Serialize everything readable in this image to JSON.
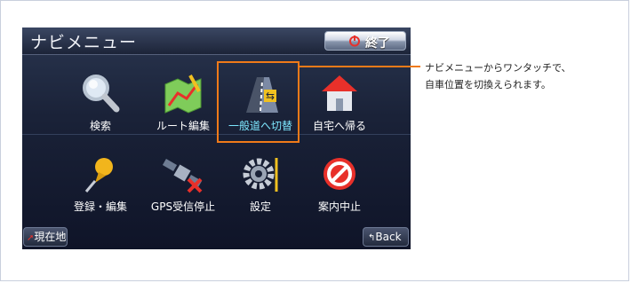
{
  "screen": {
    "title": "ナビメニュー",
    "end_button": "終了",
    "tiles": [
      {
        "label": "検索",
        "icon": "magnifier-icon"
      },
      {
        "label": "ルート編集",
        "icon": "route-map-icon"
      },
      {
        "label": "一般道へ切替",
        "icon": "road-switch-icon",
        "highlighted": true
      },
      {
        "label": "自宅へ帰る",
        "icon": "home-icon"
      },
      {
        "label": "登録・編集",
        "icon": "pushpin-icon"
      },
      {
        "label": "GPS受信停止",
        "icon": "gps-satellite-off-icon"
      },
      {
        "label": "設定",
        "icon": "gear-icon"
      },
      {
        "label": "案内中止",
        "icon": "prohibited-icon"
      }
    ],
    "current_location_button": "現在地",
    "back_button": "Back"
  },
  "callout": {
    "line1": "ナビメニューからワンタッチで、",
    "line2": "自車位置を切換えられます。"
  },
  "colors": {
    "highlight": "#f07a19",
    "highlight_label": "#7ee8ff"
  }
}
